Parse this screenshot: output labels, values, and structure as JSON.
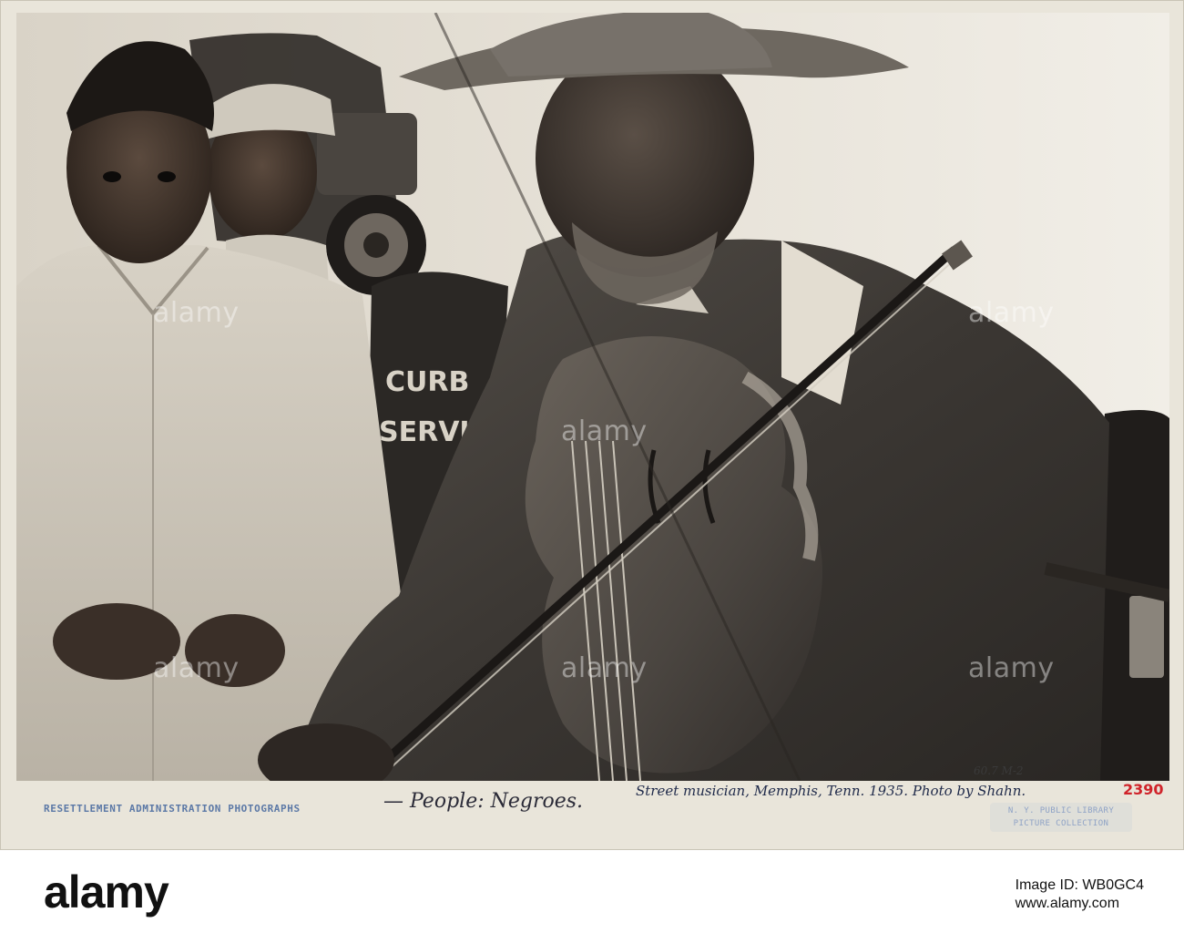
{
  "photo": {
    "sign_text_line1": "CURB",
    "sign_text_line2": "SERVIC",
    "watermark": "alamy"
  },
  "mount": {
    "stamp_label": "RESETTLEMENT ADMINISTRATION PHOTOGRAPHS",
    "hand_caption": "— People: Negroes.",
    "hand_note": "Street musician, Memphis, Tenn. 1935. Photo by Shahn.",
    "hand_number": "2390",
    "pencil_code": "60.7 M-2",
    "library_stamp_line1": "N. Y. PUBLIC LIBRARY",
    "library_stamp_line2": "PICTURE COLLECTION"
  },
  "stock_bar": {
    "logo": "alamy",
    "image_id_label": "Image ID: WB0GC4",
    "site": "www.alamy.com"
  }
}
